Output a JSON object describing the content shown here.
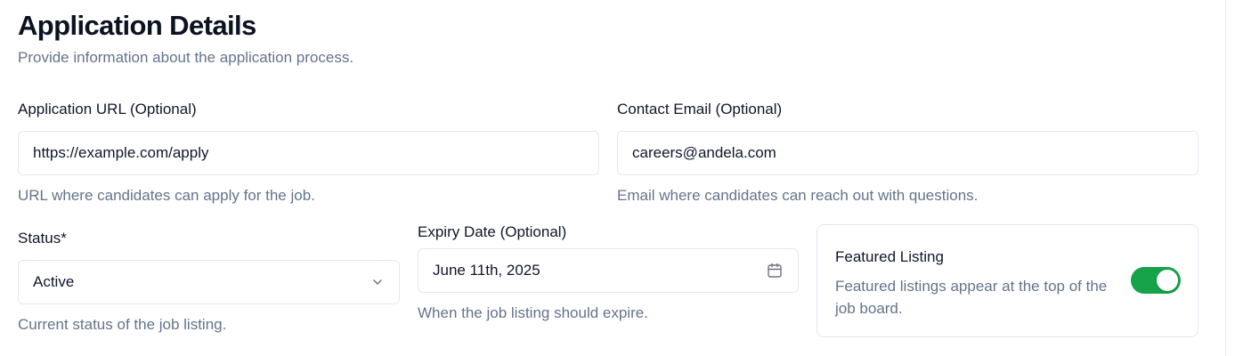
{
  "header": {
    "title": "Application Details",
    "subtitle": "Provide information about the application process."
  },
  "application_url": {
    "label": "Application URL (Optional)",
    "value": "https://example.com/apply",
    "help": "URL where candidates can apply for the job."
  },
  "contact_email": {
    "label": "Contact Email (Optional)",
    "value": "careers@andela.com",
    "help": "Email where candidates can reach out with questions."
  },
  "status": {
    "label": "Status*",
    "value": "Active",
    "help": "Current status of the job listing.",
    "icon": "chevron-down-icon"
  },
  "expiry_date": {
    "label": "Expiry Date (Optional)",
    "value": "June 11th, 2025",
    "help": "When the job listing should expire.",
    "icon": "calendar-icon"
  },
  "featured": {
    "title": "Featured Listing",
    "description": "Featured listings appear at the top of the job board.",
    "enabled": true
  },
  "colors": {
    "toggle_on": "#16a34a",
    "muted_text": "#64748b",
    "border": "#e2e8f0"
  }
}
